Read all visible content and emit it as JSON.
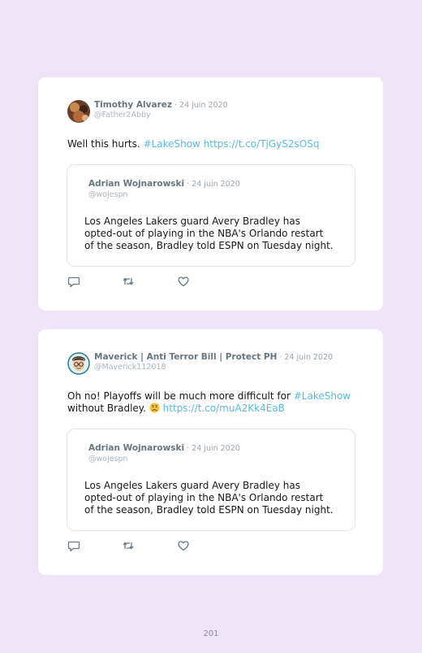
{
  "tweets": [
    {
      "author_name": "Timothy Alvarez",
      "date": " · 24 juin 2020",
      "handle": "@Father2Abby",
      "text_plain": "Well this hurts. ",
      "hashtag": "#LakeShow",
      "link": " https://t.co/TjGyS2sOSq",
      "quoted": {
        "author_name": "Adrian Wojnarowski",
        "date": " · 24 juin 2020",
        "handle": "@wojespn",
        "text": "Los Angeles Lakers guard Avery Bradley has opted-out of playing in the NBA's Orlando restart of the season, Bradley told ESPN on Tuesday night."
      }
    },
    {
      "author_name": "Maverick | Anti Terror Bill | Protect PH",
      "date": " · 24 juin 2020",
      "handle": "@Maverick112018",
      "text_plain": "Oh no! Playoffs will be much more difficult for ",
      "hashtag": "#LakeShow",
      "text_after": " without Bradley. ",
      "emoji": "worried-face",
      "link": " https://t.co/muA2Kk4EaB",
      "quoted": {
        "author_name": "Adrian Wojnarowski",
        "date": " · 24 juin 2020",
        "handle": "@wojespn",
        "text": "Los Angeles Lakers guard Avery Bradley has opted-out of playing in the NBA's Orlando restart of the season, Bradley told ESPN on Tuesday night."
      }
    }
  ],
  "icons": {
    "reply": "reply-icon",
    "retweet": "retweet-icon",
    "like": "like-icon"
  },
  "colors": {
    "page_background": "#efe3f6",
    "card_background": "#ffffff",
    "link": "#59b9e8",
    "name": "#66757f",
    "muted": "#9aa5ad"
  },
  "page_number": "201"
}
